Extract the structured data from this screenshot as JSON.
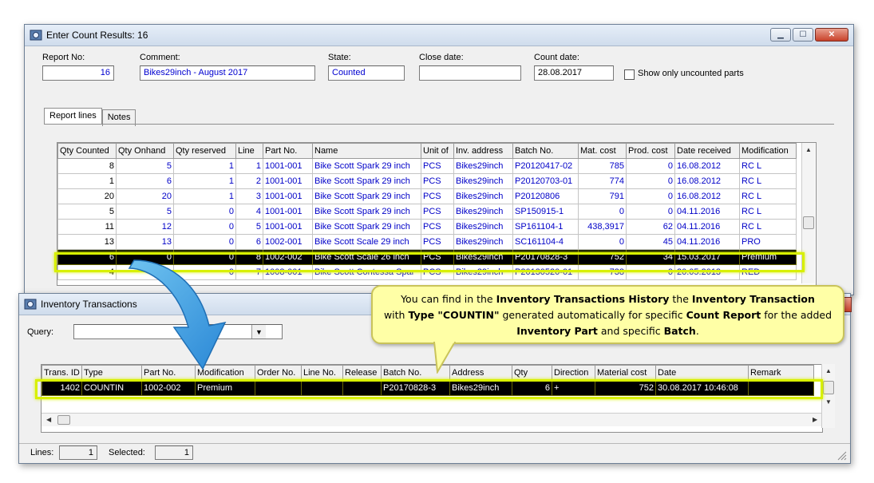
{
  "main_window": {
    "title": "Enter Count Results: 16",
    "labels": {
      "report_no": "Report No:",
      "comment": "Comment:",
      "state": "State:",
      "close_date": "Close date:",
      "count_date": "Count date:",
      "show_uncounted": "Show only uncounted parts"
    },
    "values": {
      "report_no": "16",
      "comment": "Bikes29inch - August 2017",
      "state": "Counted",
      "close_date": "",
      "count_date": "28.08.2017"
    },
    "tabs": [
      "Report lines",
      "Notes"
    ],
    "columns": [
      "Qty Counted",
      "Qty Onhand",
      "Qty reserved",
      "Line",
      "Part No.",
      "Name",
      "Unit of",
      "Inv. address",
      "Batch No.",
      "Mat. cost",
      "Prod. cost",
      "Date received",
      "Modification"
    ],
    "rows": [
      [
        "8",
        "5",
        "1",
        "1",
        "1001-001",
        "Bike Scott Spark 29 inch",
        "PCS",
        "Bikes29inch",
        "P20120417-02",
        "785",
        "0",
        "16.08.2012",
        "RC L"
      ],
      [
        "1",
        "6",
        "1",
        "2",
        "1001-001",
        "Bike Scott Spark 29 inch",
        "PCS",
        "Bikes29inch",
        "P20120703-01",
        "774",
        "0",
        "16.08.2012",
        "RC L"
      ],
      [
        "20",
        "20",
        "1",
        "3",
        "1001-001",
        "Bike Scott Spark 29 inch",
        "PCS",
        "Bikes29inch",
        "P20120806",
        "791",
        "0",
        "16.08.2012",
        "RC L"
      ],
      [
        "5",
        "5",
        "0",
        "4",
        "1001-001",
        "Bike Scott Spark 29 inch",
        "PCS",
        "Bikes29inch",
        "SP150915-1",
        "0",
        "0",
        "04.11.2016",
        "RC L"
      ],
      [
        "11",
        "12",
        "0",
        "5",
        "1001-001",
        "Bike Scott Spark 29 inch",
        "PCS",
        "Bikes29inch",
        "SP161104-1",
        "438,3917",
        "62",
        "04.11.2016",
        "RC L"
      ],
      [
        "13",
        "13",
        "0",
        "6",
        "1002-001",
        "Bike Scott Scale 29 inch",
        "PCS",
        "Bikes29inch",
        "SC161104-4",
        "0",
        "45",
        "04.11.2016",
        "PRO"
      ],
      [
        "6",
        "0",
        "0",
        "8",
        "1002-002",
        "Bike Scott Scale 26 inch",
        "PCS",
        "Bikes29inch",
        "P20170828-3",
        "752",
        "34",
        "15.03.2017",
        "Premium"
      ],
      [
        "4",
        "",
        "0",
        "7",
        "1008-001",
        "Bike Scott Contessa Spar",
        "PCS",
        "Bikes29inch",
        "P20130520-01",
        "738",
        "0",
        "20.05.2013",
        "RED"
      ]
    ]
  },
  "inv_window": {
    "title": "Inventory Transactions",
    "query_label": "Query:",
    "query_value": "",
    "columns": [
      "Trans. ID",
      "Type",
      "Part No.",
      "Modification",
      "Order No.",
      "Line No.",
      "Release",
      "Batch No.",
      "Address",
      "Qty",
      "Direction",
      "Material cost",
      "Date",
      "Remark"
    ],
    "rows": [
      [
        "1402",
        "COUNTIN",
        "1002-002",
        "Premium",
        "",
        "",
        "",
        "P20170828-3",
        "Bikes29inch",
        "6",
        "+",
        "752",
        "30.08.2017 10:46:08",
        ""
      ]
    ],
    "status": {
      "lines_label": "Lines:",
      "lines_value": "1",
      "selected_label": "Selected:",
      "selected_value": "1"
    }
  },
  "callout": {
    "t1": "You can find in the ",
    "b1": "Inventory Transactions History",
    "t2": " the ",
    "b2": "Inventory Transaction",
    "t3": " with ",
    "b3": "Type \"COUNTIN\"",
    "t4": " generated automatically for specific ",
    "b4": "Count Report",
    "t5": " for the added ",
    "b5": "Inventory Part",
    "t6": " and specific ",
    "b6": "Batch",
    "t7": "."
  },
  "colors": {
    "highlight": "#d8f000",
    "callout_bg": "#ffffa6",
    "arrow": "#3a9de0",
    "link_text": "#0000c8"
  }
}
